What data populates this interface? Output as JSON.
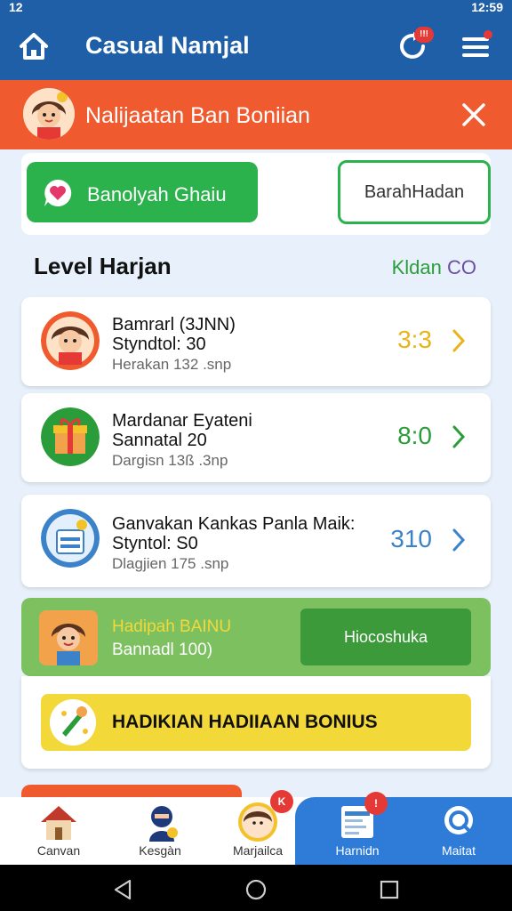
{
  "status_bar": {
    "time": "12:59",
    "left_text": "12"
  },
  "app_bar": {
    "title": "Casual Namjal",
    "refresh_badge": "!!!"
  },
  "banner": {
    "text": "Nalijaatan Ban Boniian"
  },
  "top_buttons": {
    "primary_label": "Banolyah Ghaiu",
    "secondary_label": "BarahHadan"
  },
  "section": {
    "title": "Level Harjan",
    "right_label": "Kldan",
    "right_value": "CO"
  },
  "items": [
    {
      "title": "Bamrarl (3JNN)",
      "subtitle": "Styndtol: 30",
      "detail": "Herakan 132 .snp",
      "value": "3:3",
      "value_color": "#e8b418",
      "chevron_color": "#e8b418"
    },
    {
      "title": "Mardanar Eyateni",
      "subtitle": "Sannatal 20",
      "detail": "Dargisn 13ß .3np",
      "value": "8:0",
      "value_color": "#2a9d3a",
      "chevron_color": "#2a9d3a"
    },
    {
      "title": "Ganvakan Kankas Panla Maik:",
      "subtitle": "Styntol: S0",
      "detail": "Dlagjien 175 .snp",
      "value": "310",
      "value_color": "#3b82c8",
      "chevron_color": "#3b82c8"
    }
  ],
  "promo": {
    "title": "Hadipah BAINU",
    "subtitle": "Bannadl 100)",
    "button_label": "Hiocoshuka"
  },
  "bonus": {
    "label": "HADIKIAN HADIIAAN BONIUS"
  },
  "bottom_nav": [
    {
      "label": "Canvan",
      "icon": "house-icon"
    },
    {
      "label": "Kesgàn",
      "icon": "ninja-icon"
    },
    {
      "label": "Marjailca",
      "icon": "avatar-icon",
      "badge": "K"
    },
    {
      "label": "Harnidn",
      "icon": "document-icon",
      "badge": "!"
    },
    {
      "label": "Maitat",
      "icon": "search-icon"
    }
  ],
  "colors": {
    "brand": "#1f5fa8",
    "banner": "#ef5a2f",
    "accent_green": "#2bb24c",
    "bonus_yellow": "#f3d83a"
  }
}
